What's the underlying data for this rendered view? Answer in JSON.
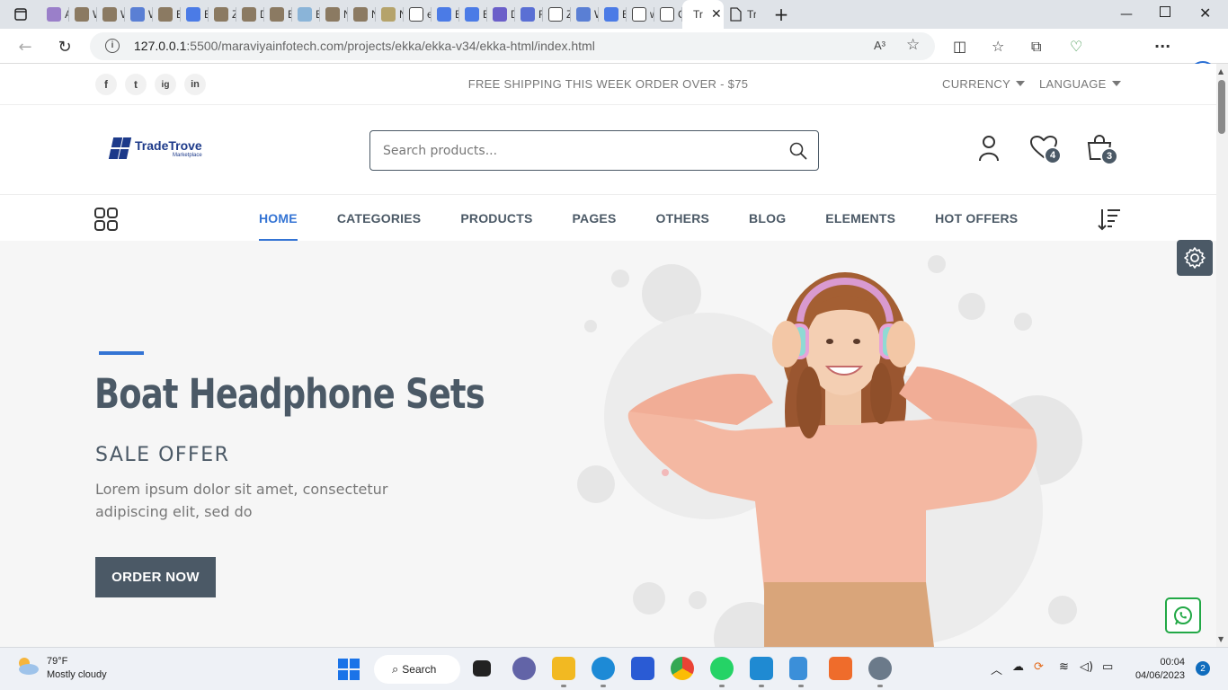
{
  "browser": {
    "tabs": [
      {
        "title": "A",
        "color": "#9a7fc9"
      },
      {
        "title": "W",
        "color": "#8b7a62"
      },
      {
        "title": "W",
        "color": "#8b7a62"
      },
      {
        "title": "W",
        "color": "#5a7fd4"
      },
      {
        "title": "El",
        "color": "#8b7a62"
      },
      {
        "title": "El",
        "color": "#4b7be6"
      },
      {
        "title": "Z",
        "color": "#8b7a62"
      },
      {
        "title": "D",
        "color": "#8b7a62"
      },
      {
        "title": "E",
        "color": "#8b7a62"
      },
      {
        "title": "E",
        "color": "#8ab4d8"
      },
      {
        "title": "N",
        "color": "#8b7a62"
      },
      {
        "title": "N",
        "color": "#8b7a62"
      },
      {
        "title": "N",
        "color": "#b5a36b"
      },
      {
        "title": "e",
        "color": "#ffffff"
      },
      {
        "title": "El",
        "color": "#4b7be6"
      },
      {
        "title": "El",
        "color": "#4b7be6"
      },
      {
        "title": "D",
        "color": "#6b5fc9"
      },
      {
        "title": "R",
        "color": "#5a6fd4"
      },
      {
        "title": "Z",
        "color": "#ffffff"
      },
      {
        "title": "W",
        "color": "#5a7fd4"
      },
      {
        "title": "El",
        "color": "#4b7be6"
      },
      {
        "title": "w",
        "color": "#ffffff"
      },
      {
        "title": "C",
        "color": "#ffffff"
      }
    ],
    "active_tab": {
      "title": "Tr",
      "close": "✕"
    },
    "extra_tab": {
      "title": "Tr"
    },
    "new_tab": "+",
    "url_host": "127.0.0.1",
    "url_rest": ":5500/maraviyainfotech.com/projects/ekka/ekka-v34/ekka-html/index.html",
    "read_aloud": "A³"
  },
  "topbar": {
    "social": [
      "f",
      "t",
      "ig",
      "in"
    ],
    "shipping": "FREE SHIPPING THIS WEEK ORDER OVER - $75",
    "currency": "CURRENCY",
    "language": "LANGUAGE"
  },
  "header": {
    "logo_name": "TradeTrove",
    "logo_tag": "Marketplace",
    "search_placeholder": "Search products...",
    "wishlist_count": "4",
    "cart_count": "3"
  },
  "nav": {
    "items": [
      "HOME",
      "CATEGORIES",
      "PRODUCTS",
      "PAGES",
      "OTHERS",
      "BLOG",
      "ELEMENTS",
      "HOT OFFERS"
    ],
    "active": "HOME"
  },
  "hero": {
    "title": "Boat Headphone Sets",
    "subtitle": "SALE OFFER",
    "text": "Lorem ipsum dolor sit amet, consectetur adipiscing elit, sed do",
    "button": "ORDER NOW"
  },
  "taskbar": {
    "temp": "79°F",
    "weather": "Mostly cloudy",
    "search": "Search",
    "time": "00:04",
    "date": "04/06/2023",
    "notifications": "2"
  },
  "colors": {
    "accent": "#3474d4",
    "dark": "#4b5966",
    "whatsapp": "#22a846"
  }
}
